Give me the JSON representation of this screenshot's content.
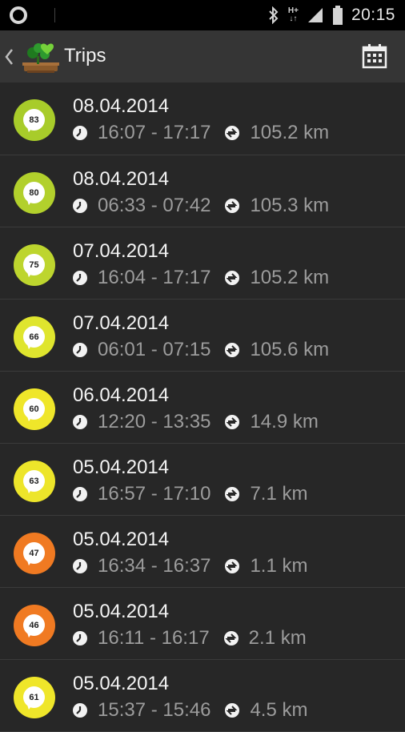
{
  "status_bar": {
    "time": "20:15",
    "network_top": "H+",
    "network_bottom": "↓↑"
  },
  "header": {
    "title": "Trips"
  },
  "colors": {
    "score_83": "#a8cc2a",
    "score_80": "#b2d02c",
    "score_75": "#bdd52e",
    "score_66": "#dfe52e",
    "score_60": "#efe62a",
    "score_63": "#ede52a",
    "score_47": "#f07a22",
    "score_46": "#f07a22",
    "score_61": "#efe62a"
  },
  "trips": [
    {
      "score": "83",
      "date": "08.04.2014",
      "time": "16:07 - 17:17",
      "distance": "105.2 km",
      "color": "#a8cc2a"
    },
    {
      "score": "80",
      "date": "08.04.2014",
      "time": "06:33 - 07:42",
      "distance": "105.3 km",
      "color": "#b2d02c"
    },
    {
      "score": "75",
      "date": "07.04.2014",
      "time": "16:04 - 17:17",
      "distance": "105.2 km",
      "color": "#bdd52e"
    },
    {
      "score": "66",
      "date": "07.04.2014",
      "time": "06:01 - 07:15",
      "distance": "105.6 km",
      "color": "#dfe52e"
    },
    {
      "score": "60",
      "date": "06.04.2014",
      "time": "12:20 - 13:35",
      "distance": "14.9 km",
      "color": "#efe62a"
    },
    {
      "score": "63",
      "date": "05.04.2014",
      "time": "16:57 - 17:10",
      "distance": "7.1 km",
      "color": "#ede52a"
    },
    {
      "score": "47",
      "date": "05.04.2014",
      "time": "16:34 - 16:37",
      "distance": "1.1 km",
      "color": "#f07a22"
    },
    {
      "score": "46",
      "date": "05.04.2014",
      "time": "16:11 - 16:17",
      "distance": "2.1 km",
      "color": "#f07a22"
    },
    {
      "score": "61",
      "date": "05.04.2014",
      "time": "15:37 - 15:46",
      "distance": "4.5 km",
      "color": "#efe62a"
    }
  ],
  "icons": {
    "time": "clock-icon",
    "distance": "distance-arrow-icon",
    "calendar": "calendar-icon",
    "back": "chevron-left-icon"
  }
}
